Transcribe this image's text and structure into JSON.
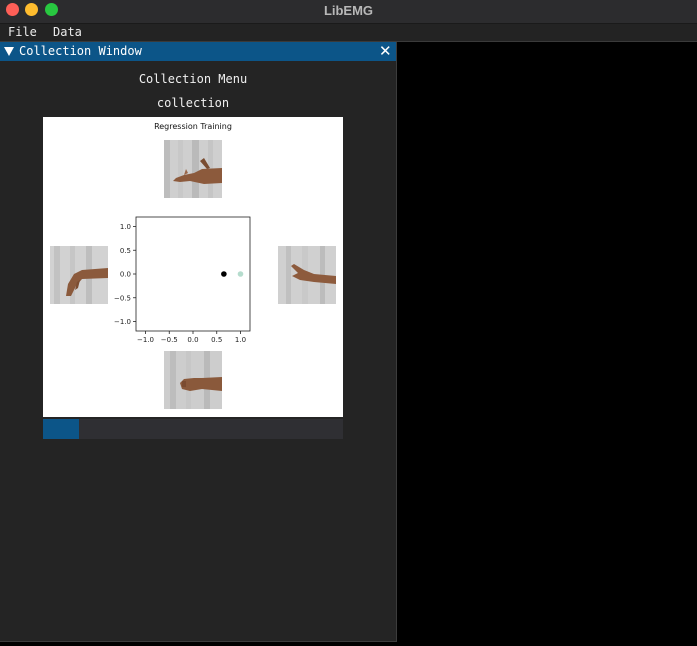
{
  "app": {
    "title": "LibEMG"
  },
  "menubar": {
    "items": [
      "File",
      "Data"
    ]
  },
  "collection_window": {
    "title": "Collection Window",
    "close_glyph": "✕",
    "heading": "Collection Menu",
    "subheading": "collection",
    "progress": 0.12,
    "progress_color": "#0c5588"
  },
  "figure": {
    "gesture_images": [
      {
        "position": "top",
        "depicts": "open hand / wrist extension"
      },
      {
        "position": "left",
        "depicts": "wrist flexion"
      },
      {
        "position": "right",
        "depicts": "wrist extension"
      },
      {
        "position": "bottom",
        "depicts": "closed fist"
      }
    ]
  },
  "chart_data": {
    "type": "scatter",
    "title": "Regression Training",
    "xlabel": "",
    "ylabel": "",
    "xlim": [
      -1.2,
      1.2
    ],
    "ylim": [
      -1.2,
      1.2
    ],
    "xticks": [
      -1.0,
      -0.5,
      0.0,
      0.5,
      1.0
    ],
    "yticks": [
      -1.0,
      -0.5,
      0.0,
      0.5,
      1.0
    ],
    "xtick_labels": [
      "−1.0",
      "−0.5",
      "0.0",
      "0.5",
      "1.0"
    ],
    "ytick_labels": [
      "−1.0",
      "−0.5",
      "0.0",
      "0.5",
      "1.0"
    ],
    "grid": false,
    "series": [
      {
        "x": [
          0.65
        ],
        "y": [
          0.0
        ],
        "color": "#000000"
      },
      {
        "x": [
          1.0
        ],
        "y": [
          0.0
        ],
        "color": "#b5dccd"
      }
    ]
  }
}
